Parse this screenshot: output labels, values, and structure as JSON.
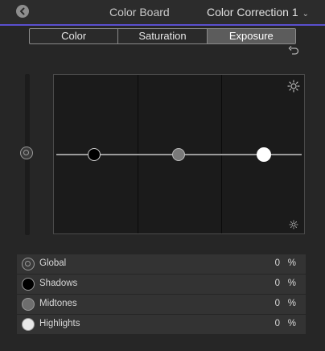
{
  "header": {
    "title": "Color Board",
    "correction_label": "Color Correction 1"
  },
  "tabs": [
    {
      "label": "Color",
      "active": false
    },
    {
      "label": "Saturation",
      "active": false
    },
    {
      "label": "Exposure",
      "active": true
    }
  ],
  "rows": [
    {
      "label": "Global",
      "value": "0",
      "unit": "%"
    },
    {
      "label": "Shadows",
      "value": "0",
      "unit": "%"
    },
    {
      "label": "Midtones",
      "value": "0",
      "unit": "%"
    },
    {
      "label": "Highlights",
      "value": "0",
      "unit": "%"
    }
  ],
  "colors": {
    "accent": "#5a4fcf",
    "background": "#262626",
    "board": "#1b1b1b",
    "active_tab": "#5c5c5c"
  },
  "icons": {
    "back": "back-arrow-icon",
    "dropdown": "chevron-down-icon",
    "reset": "reset-icon",
    "bright": "sun-icon"
  }
}
